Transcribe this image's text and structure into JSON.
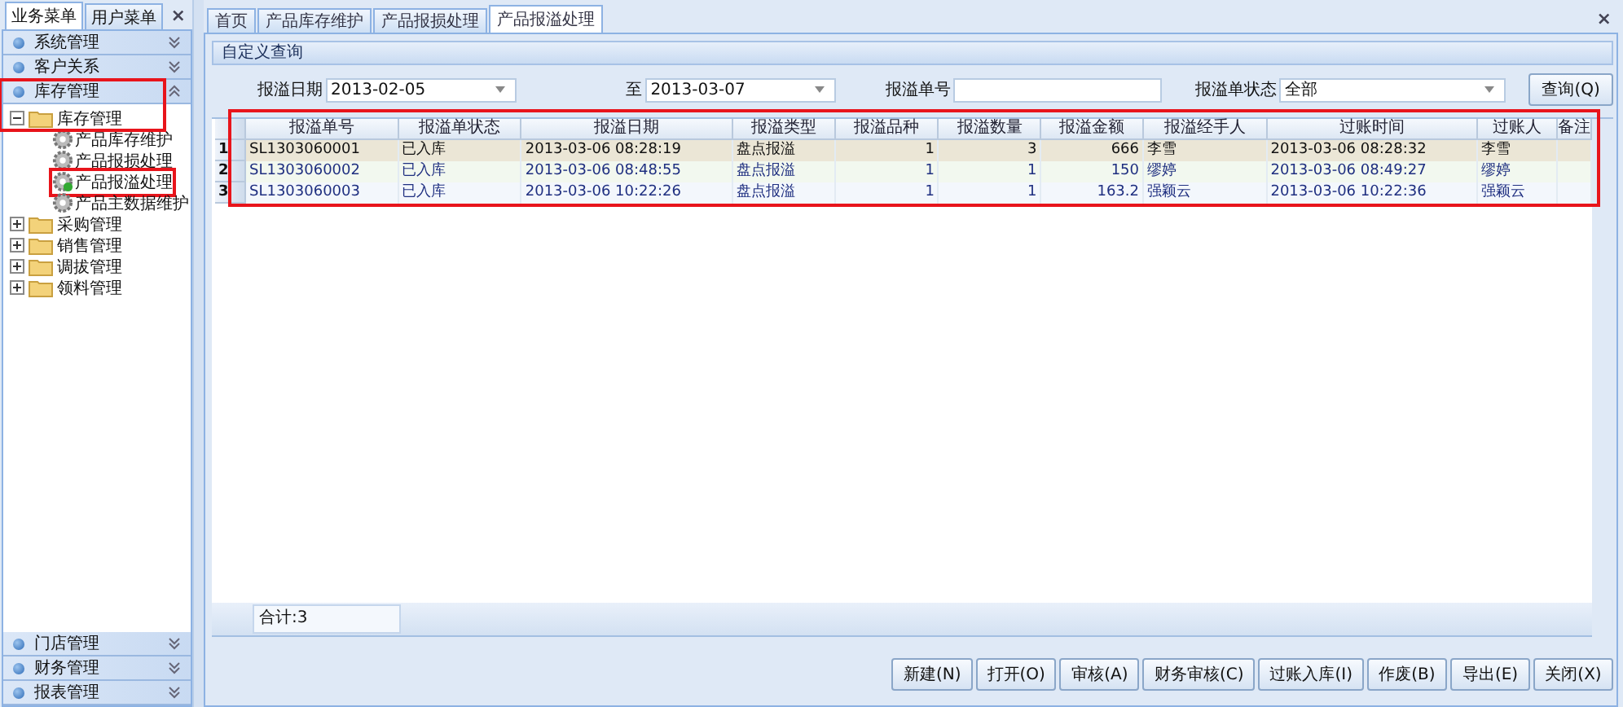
{
  "sidebar": {
    "tabs": [
      {
        "label": "业务菜单",
        "selected": true
      },
      {
        "label": "用户菜单",
        "selected": false
      }
    ],
    "close": "×",
    "top_sections": [
      {
        "label": "系统管理",
        "expanded": false,
        "highlighted": false
      },
      {
        "label": "客户关系",
        "expanded": false,
        "highlighted": false
      },
      {
        "label": "库存管理",
        "expanded": true,
        "highlighted": true
      }
    ],
    "tree": [
      {
        "label": "库存管理",
        "kind": "folder",
        "expanded": true,
        "highlighted": false,
        "children": [
          {
            "label": "产品库存维护",
            "kind": "leaf",
            "selected": false,
            "highlighted": false
          },
          {
            "label": "产品报损处理",
            "kind": "leaf",
            "selected": false,
            "highlighted": false
          },
          {
            "label": "产品报溢处理",
            "kind": "leaf",
            "selected": true,
            "highlighted": true
          },
          {
            "label": "产品主数据维护",
            "kind": "leaf",
            "selected": false,
            "highlighted": false
          }
        ]
      },
      {
        "label": "采购管理",
        "kind": "folder",
        "expanded": false,
        "highlighted": false
      },
      {
        "label": "销售管理",
        "kind": "folder",
        "expanded": false,
        "highlighted": false
      },
      {
        "label": "调拔管理",
        "kind": "folder",
        "expanded": false,
        "highlighted": false
      },
      {
        "label": "领料管理",
        "kind": "folder",
        "expanded": false,
        "highlighted": false
      }
    ],
    "bottom_sections": [
      {
        "label": "门店管理",
        "expanded": false
      },
      {
        "label": "财务管理",
        "expanded": false
      },
      {
        "label": "报表管理",
        "expanded": false
      }
    ]
  },
  "tabs": [
    {
      "label": "首页",
      "selected": false
    },
    {
      "label": "产品库存维护",
      "selected": false
    },
    {
      "label": "产品报损处理",
      "selected": false
    },
    {
      "label": "产品报溢处理",
      "selected": true
    }
  ],
  "close": "×",
  "query_title": "自定义查询",
  "filters": [
    {
      "kind": "date",
      "label": "报溢日期",
      "value": "2013-02-05"
    },
    {
      "kind": "date",
      "label": "至",
      "value": "2013-03-07"
    },
    {
      "kind": "text",
      "label": "报溢单号"
    },
    {
      "kind": "select",
      "label": "报溢单状态",
      "value": "全部"
    }
  ],
  "query_button": "查询(Q)",
  "table": {
    "highlighted": true,
    "columns": [
      {
        "label": "报溢单号",
        "kind": "text"
      },
      {
        "label": "报溢单状态",
        "kind": "text"
      },
      {
        "label": "报溢日期",
        "kind": "text"
      },
      {
        "label": "报溢类型",
        "kind": "text"
      },
      {
        "label": "报溢品种",
        "kind": "number"
      },
      {
        "label": "报溢数量",
        "kind": "number"
      },
      {
        "label": "报溢金额",
        "kind": "number"
      },
      {
        "label": "报溢经手人",
        "kind": "text"
      },
      {
        "label": "过账时间",
        "kind": "text"
      },
      {
        "label": "过账人",
        "kind": "text"
      },
      {
        "label": "备注",
        "kind": "text"
      }
    ],
    "rows": [
      {
        "index": "1",
        "selected": true,
        "cells": [
          "SL1303060001",
          "已入库",
          "2013-03-06 08:28:19",
          "盘点报溢",
          "1",
          "3",
          "666",
          "李雪",
          "2013-03-06 08:28:32",
          "李雪",
          ""
        ]
      },
      {
        "index": "2",
        "selected": false,
        "cells": [
          "SL1303060002",
          "已入库",
          "2013-03-06 08:48:55",
          "盘点报溢",
          "1",
          "1",
          "150",
          "缪婷",
          "2013-03-06 08:49:27",
          "缪婷",
          ""
        ]
      },
      {
        "index": "3",
        "selected": false,
        "cells": [
          "SL1303060003",
          "已入库",
          "2013-03-06 10:22:26",
          "盘点报溢",
          "1",
          "1",
          "163.2",
          "强颖云",
          "2013-03-06 10:22:36",
          "强颖云",
          ""
        ]
      }
    ]
  },
  "summary": "合计:3",
  "buttons": [
    "新建(N)",
    "打开(O)",
    "审核(A)",
    "财务审核(C)",
    "过账入库(I)",
    "作废(B)",
    "导出(E)",
    "关闭(X)"
  ]
}
